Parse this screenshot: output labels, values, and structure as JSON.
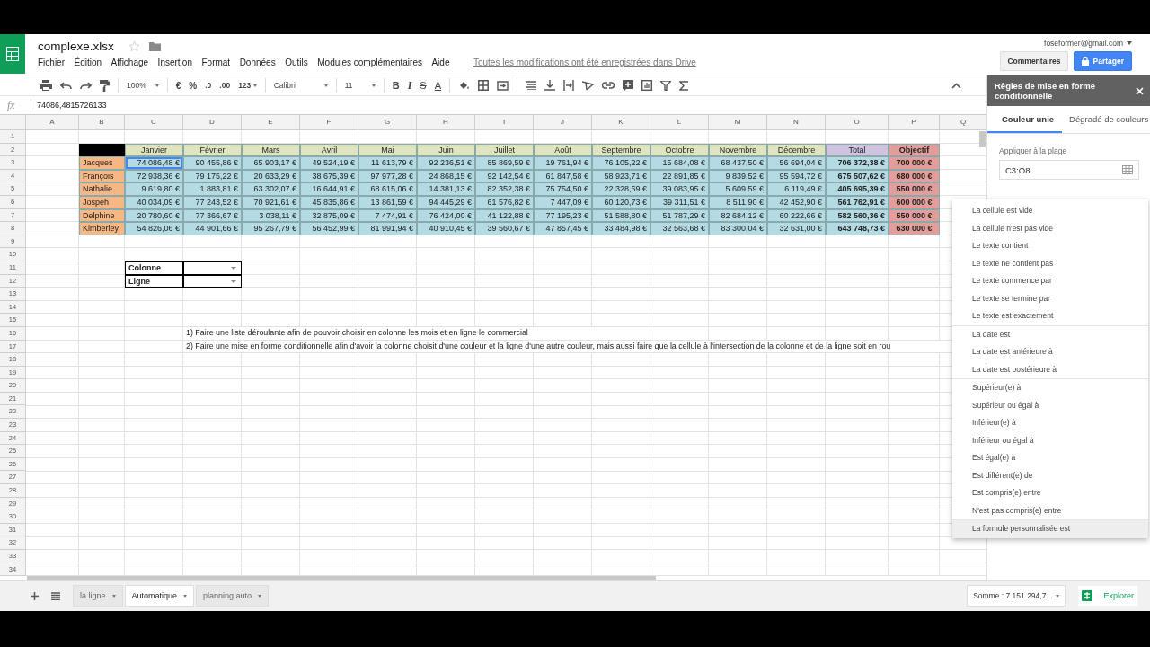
{
  "document": {
    "title": "complexe.xlsx",
    "account": "foseformer@gmail.com",
    "save_status": "Toutes les modifications ont été enregistrées dans Drive"
  },
  "menu": [
    "Fichier",
    "Édition",
    "Affichage",
    "Insertion",
    "Format",
    "Données",
    "Outils",
    "Modules complémentaires",
    "Aide"
  ],
  "buttons": {
    "comments": "Commentaires",
    "share": "Partager"
  },
  "toolbar": {
    "zoom": "100%",
    "currency": "€",
    "percent": "%",
    "decimal_less": ".0",
    "decimal_more": ".00",
    "number_format": "123",
    "font": "Calibri",
    "font_size": "11",
    "bold": "B",
    "italic": "I",
    "strikethrough": "S",
    "text_color": "A"
  },
  "formula_bar": {
    "label": "fx",
    "value": "74086,4815726133"
  },
  "sheet": {
    "columns": [
      "A",
      "B",
      "C",
      "D",
      "E",
      "F",
      "G",
      "H",
      "I",
      "J",
      "K",
      "L",
      "M",
      "N",
      "O",
      "P",
      "Q"
    ],
    "row_numbers": [
      "1",
      "2",
      "3",
      "4",
      "5",
      "6",
      "7",
      "8",
      "9",
      "10",
      "11",
      "12",
      "13",
      "14",
      "15",
      "16",
      "17",
      "18",
      "19",
      "20",
      "21",
      "22",
      "23",
      "24",
      "25",
      "26",
      "27",
      "28",
      "29",
      "30",
      "31",
      "32",
      "33",
      "34"
    ],
    "table": {
      "header": [
        "Janvier",
        "Février",
        "Mars",
        "Avril",
        "Mai",
        "Juin",
        "Juillet",
        "Août",
        "Septembre",
        "Octobre",
        "Novembre",
        "Décembre"
      ],
      "total_header": "Total",
      "objective_header": "Objectif",
      "rows": [
        {
          "name": "Jacques",
          "values": [
            {
              "text": "74 086,48 €",
              "selected": true
            },
            {
              "text": "90 455,86 €",
              "selected": false
            },
            {
              "text": "65 903,17 €",
              "selected": false
            },
            {
              "text": "49 524,19 €",
              "selected": false
            },
            {
              "text": "11 613,79 €",
              "selected": false
            },
            {
              "text": "92 236,51 €",
              "selected": false
            },
            {
              "text": "85 869,59 €",
              "selected": false
            },
            {
              "text": "19 761,94 €",
              "selected": false
            },
            {
              "text": "76 105,22 €",
              "selected": false
            },
            {
              "text": "15 684,08 €",
              "selected": false
            },
            {
              "text": "68 437,50 €",
              "selected": false
            },
            {
              "text": "56 694,04 €",
              "selected": false
            }
          ],
          "total": "706 372,38 €",
          "objective": "700 000 €"
        },
        {
          "name": "François",
          "values": [
            {
              "text": "72 938,36 €",
              "selected": false
            },
            {
              "text": "79 175,22 €",
              "selected": false
            },
            {
              "text": "20 633,29 €",
              "selected": false
            },
            {
              "text": "38 675,39 €",
              "selected": false
            },
            {
              "text": "97 977,28 €",
              "selected": false
            },
            {
              "text": "24 868,15 €",
              "selected": false
            },
            {
              "text": "92 142,54 €",
              "selected": false
            },
            {
              "text": "61 847,58 €",
              "selected": false
            },
            {
              "text": "58 923,71 €",
              "selected": false
            },
            {
              "text": "22 891,85 €",
              "selected": false
            },
            {
              "text": "9 839,52 €",
              "selected": false
            },
            {
              "text": "95 594,72 €",
              "selected": false
            }
          ],
          "total": "675 507,62 €",
          "objective": "680 000 €"
        },
        {
          "name": "Nathalie",
          "values": [
            {
              "text": "9 619,80 €",
              "selected": false
            },
            {
              "text": "1 883,81 €",
              "selected": false
            },
            {
              "text": "63 302,07 €",
              "selected": false
            },
            {
              "text": "16 644,91 €",
              "selected": false
            },
            {
              "text": "68 615,06 €",
              "selected": false
            },
            {
              "text": "14 381,13 €",
              "selected": false
            },
            {
              "text": "82 352,38 €",
              "selected": false
            },
            {
              "text": "75 754,50 €",
              "selected": false
            },
            {
              "text": "22 328,69 €",
              "selected": false
            },
            {
              "text": "39 083,95 €",
              "selected": false
            },
            {
              "text": "5 609,59 €",
              "selected": false
            },
            {
              "text": "6 119,49 €",
              "selected": false
            }
          ],
          "total": "405 695,39 €",
          "objective": "550 000 €"
        },
        {
          "name": "Jospeh",
          "values": [
            {
              "text": "40 034,09 €",
              "selected": false
            },
            {
              "text": "77 243,52 €",
              "selected": false
            },
            {
              "text": "70 921,61 €",
              "selected": false
            },
            {
              "text": "45 835,86 €",
              "selected": false
            },
            {
              "text": "13 861,59 €",
              "selected": false
            },
            {
              "text": "94 445,29 €",
              "selected": false
            },
            {
              "text": "61 576,82 €",
              "selected": false
            },
            {
              "text": "7 447,09 €",
              "selected": false
            },
            {
              "text": "60 120,73 €",
              "selected": false
            },
            {
              "text": "39 311,51 €",
              "selected": false
            },
            {
              "text": "8 511,90 €",
              "selected": false
            },
            {
              "text": "42 452,90 €",
              "selected": false
            }
          ],
          "total": "561 762,91 €",
          "objective": "600 000 €"
        },
        {
          "name": "Delphine",
          "values": [
            {
              "text": "20 780,60 €",
              "selected": false
            },
            {
              "text": "77 366,67 €",
              "selected": false
            },
            {
              "text": "3 038,11 €",
              "selected": false
            },
            {
              "text": "32 875,09 €",
              "selected": false
            },
            {
              "text": "7 474,91 €",
              "selected": false
            },
            {
              "text": "76 424,00 €",
              "selected": false
            },
            {
              "text": "41 122,88 €",
              "selected": false
            },
            {
              "text": "77 195,23 €",
              "selected": false
            },
            {
              "text": "51 588,80 €",
              "selected": false
            },
            {
              "text": "51 787,29 €",
              "selected": false
            },
            {
              "text": "82 684,12 €",
              "selected": false
            },
            {
              "text": "60 222,66 €",
              "selected": false
            }
          ],
          "total": "582 560,36 €",
          "objective": "550 000 €"
        },
        {
          "name": "Kimberley",
          "values": [
            {
              "text": "54 826,06 €",
              "selected": false
            },
            {
              "text": "44 901,66 €",
              "selected": false
            },
            {
              "text": "95 267,79 €",
              "selected": false
            },
            {
              "text": "56 452,99 €",
              "selected": false
            },
            {
              "text": "81 991,94 €",
              "selected": false
            },
            {
              "text": "40 910,45 €",
              "selected": false
            },
            {
              "text": "39 560,67 €",
              "selected": false
            },
            {
              "text": "47 857,45 €",
              "selected": false
            },
            {
              "text": "33 484,98 €",
              "selected": false
            },
            {
              "text": "32 563,68 €",
              "selected": false
            },
            {
              "text": "83 300,04 €",
              "selected": false
            },
            {
              "text": "32 631,00 €",
              "selected": false
            }
          ],
          "total": "643 748,73 €",
          "objective": "630 000 €"
        }
      ]
    },
    "selectors": [
      {
        "label": "Colonne"
      },
      {
        "label": "Ligne"
      }
    ],
    "notes": [
      "1) Faire une liste déroulante afin de pouvoir choisir en colonne les mois et en ligne le commercial",
      "2) Faire une mise en forme conditionnelle afin d'avoir la colonne choisit d'une couleur et la ligne d'une autre couleur, mais aussi faire que la cellule à l'intersection de la colonne et de la ligne soit en rou"
    ]
  },
  "panel": {
    "title": "Règles de mise en forme conditionnelle",
    "tabs": [
      {
        "label": "Couleur unie",
        "selected": true
      },
      {
        "label": "Dégradé de couleurs",
        "selected": false
      }
    ],
    "range_label": "Appliquer à la plage",
    "range_value": "C3:O8"
  },
  "condition_menu": {
    "groups": [
      [
        {
          "label": "La cellule est vide",
          "selected": false
        },
        {
          "label": "La cellule n'est pas vide",
          "selected": false
        },
        {
          "label": "Le texte contient",
          "selected": false
        },
        {
          "label": "Le texte ne contient pas",
          "selected": false
        },
        {
          "label": "Le texte commence par",
          "selected": false
        },
        {
          "label": "Le texte se termine par",
          "selected": false
        },
        {
          "label": "Le texte est exactement",
          "selected": false
        }
      ],
      [
        {
          "label": "La date est",
          "selected": false
        },
        {
          "label": "La date est antérieure à",
          "selected": false
        },
        {
          "label": "La date est postérieure à",
          "selected": false
        }
      ],
      [
        {
          "label": "Supérieur(e) à",
          "selected": false
        },
        {
          "label": "Supérieur ou égal à",
          "selected": false
        },
        {
          "label": "Inférieur(e) à",
          "selected": false
        },
        {
          "label": "Inférieur ou égal à",
          "selected": false
        },
        {
          "label": "Est égal(e) à",
          "selected": false
        },
        {
          "label": "Est différent(e) de",
          "selected": false
        },
        {
          "label": "Est compris(e) entre",
          "selected": false
        },
        {
          "label": "N'est pas compris(e) entre",
          "selected": false
        }
      ],
      [
        {
          "label": "La formule personnalisée est",
          "selected": true
        }
      ]
    ]
  },
  "sheet_tabs": [
    {
      "label": "la ligne",
      "selected": false
    },
    {
      "label": "Automatique",
      "selected": true
    },
    {
      "label": "planning auto",
      "selected": false
    }
  ],
  "status": {
    "sum": "Somme : 7 151 294,7...",
    "explore": "Explorer"
  }
}
